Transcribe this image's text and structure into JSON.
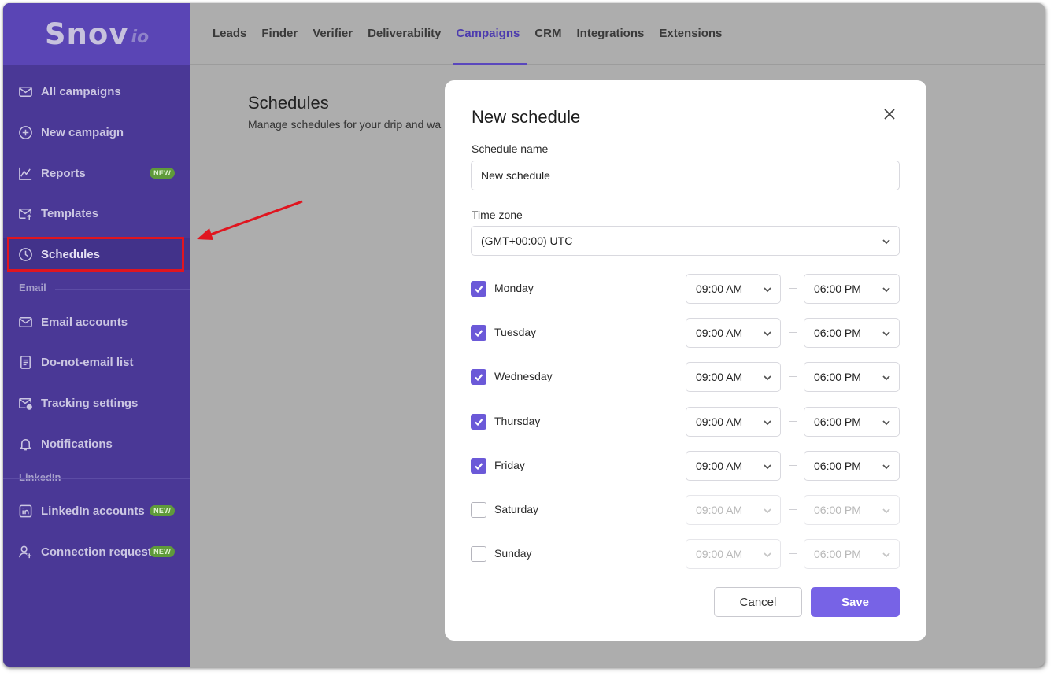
{
  "brand": {
    "logo_main": "Snov",
    "logo_sub": "io"
  },
  "topnav": {
    "tabs": [
      {
        "label": "Leads"
      },
      {
        "label": "Finder"
      },
      {
        "label": "Verifier"
      },
      {
        "label": "Deliverability"
      },
      {
        "label": "Campaigns",
        "active": true
      },
      {
        "label": "CRM"
      },
      {
        "label": "Integrations"
      },
      {
        "label": "Extensions"
      }
    ]
  },
  "sidebar": {
    "items": [
      {
        "label": "All campaigns",
        "icon": "mail-icon"
      },
      {
        "label": "New campaign",
        "icon": "plus-circle-icon"
      },
      {
        "label": "Reports",
        "icon": "chart-icon",
        "badge": "NEW"
      },
      {
        "label": "Templates",
        "icon": "template-icon"
      },
      {
        "label": "Schedules",
        "icon": "clock-icon",
        "active": true
      },
      {
        "label": "Email accounts",
        "icon": "mail-icon"
      },
      {
        "label": "Do-not-email list",
        "icon": "list-doc-icon"
      },
      {
        "label": "Tracking settings",
        "icon": "mail-tracking-icon"
      },
      {
        "label": "Notifications",
        "icon": "bell-icon"
      },
      {
        "label": "LinkedIn accounts",
        "icon": "linkedin-icon",
        "badge": "NEW"
      },
      {
        "label": "Connection requests",
        "icon": "user-plus-icon",
        "badge": "NEW"
      }
    ],
    "sections": {
      "email": "Email",
      "linkedin": "LinkedIn"
    }
  },
  "page": {
    "title": "Schedules",
    "subtitle": "Manage schedules for your drip and wa"
  },
  "modal": {
    "title": "New schedule",
    "name_label": "Schedule name",
    "name_value": "New schedule",
    "timezone_label": "Time zone",
    "timezone_value": "(GMT+00:00) UTC",
    "days": [
      {
        "label": "Monday",
        "checked": true,
        "start": "09:00 AM",
        "end": "06:00 PM"
      },
      {
        "label": "Tuesday",
        "checked": true,
        "start": "09:00 AM",
        "end": "06:00 PM"
      },
      {
        "label": "Wednesday",
        "checked": true,
        "start": "09:00 AM",
        "end": "06:00 PM"
      },
      {
        "label": "Thursday",
        "checked": true,
        "start": "09:00 AM",
        "end": "06:00 PM"
      },
      {
        "label": "Friday",
        "checked": true,
        "start": "09:00 AM",
        "end": "06:00 PM"
      },
      {
        "label": "Saturday",
        "checked": false,
        "start": "09:00 AM",
        "end": "06:00 PM"
      },
      {
        "label": "Sunday",
        "checked": false,
        "start": "09:00 AM",
        "end": "06:00 PM"
      }
    ],
    "cancel_label": "Cancel",
    "save_label": "Save"
  },
  "colors": {
    "sidebar": "#4a3896",
    "accent": "#7763e6",
    "highlight": "#e0151f",
    "badge": "#5f9a3a"
  }
}
